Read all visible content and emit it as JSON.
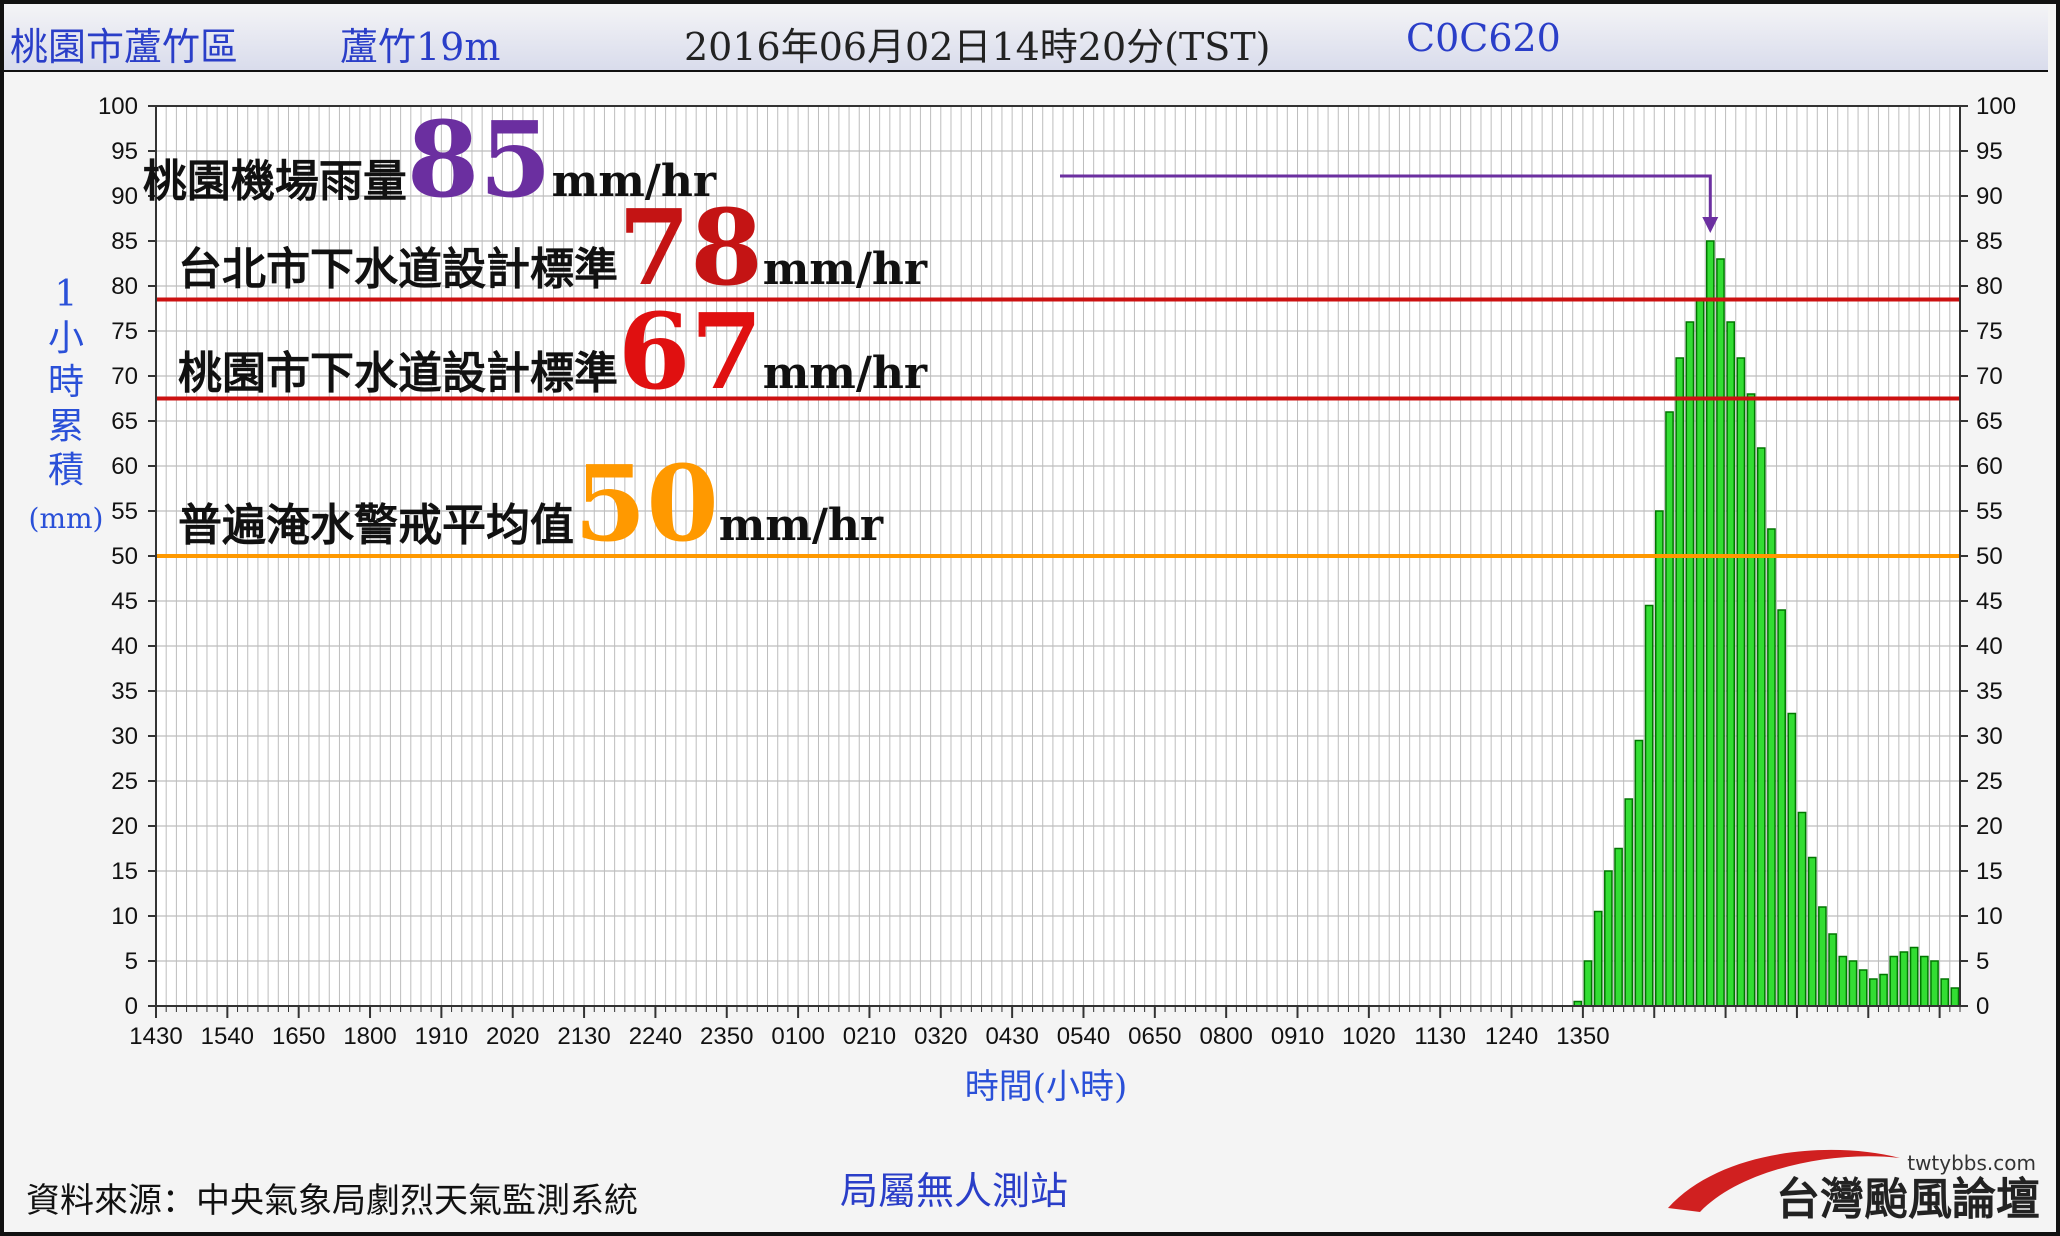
{
  "header": {
    "location": "桃園市蘆竹區",
    "station": "蘆竹19m",
    "datetime": "2016年06月02日14時20分(TST)",
    "station_code": "C0C620"
  },
  "annotations": {
    "airport_label": "桃園機場雨量",
    "airport_value": "85",
    "airport_unit": "mm/hr",
    "taipei_label": "台北市下水道設計標準",
    "taipei_value": "78",
    "taipei_unit": "mm/hr",
    "taoyuan_label": "桃園市下水道設計標準",
    "taoyuan_value": "67",
    "taoyuan_unit": "mm/hr",
    "warning_label": "普遍淹水警戒平均值",
    "warning_value": "50",
    "warning_unit": "mm/hr"
  },
  "footer": {
    "source": "資料來源：中央氣象局劇烈天氣監測系統",
    "station_type": "局屬無人測站",
    "forum_url": "twtybbs.com",
    "forum_name": "台灣颱風論壇"
  },
  "colors": {
    "bar": "#33dd33",
    "bar_edge": "#007700",
    "grid": "#bdbdbd",
    "axis_title": "#2a50d8",
    "airport": "#6b2fa0",
    "taipei": "#c41414",
    "taoyuan": "#e01010",
    "warning": "#ff9900",
    "threshold_red": "#cc1111"
  },
  "chart_data": {
    "type": "bar",
    "title": "",
    "xlabel": "時間(小時)",
    "ylabel": "1小時累積(mm)",
    "ylim": [
      0,
      100
    ],
    "yticks": [
      0,
      5,
      10,
      15,
      20,
      25,
      30,
      35,
      40,
      45,
      50,
      55,
      60,
      65,
      70,
      75,
      80,
      85,
      90,
      95,
      100
    ],
    "xticks": [
      "1430",
      "1540",
      "1650",
      "1800",
      "1910",
      "2020",
      "2130",
      "2240",
      "2350",
      "0100",
      "0210",
      "0320",
      "0430",
      "0540",
      "0650",
      "0800",
      "0910",
      "1020",
      "1130",
      "1240",
      "1350"
    ],
    "bar_interval_minutes": 10,
    "first_bar_time": "1430",
    "last_bar_time": "1420",
    "values": [
      0,
      0,
      0,
      0,
      0,
      0,
      0,
      0,
      0,
      0,
      0,
      0,
      0,
      0,
      0,
      0,
      0,
      0,
      0,
      0,
      0,
      0,
      0,
      0,
      0,
      0,
      0,
      0,
      0,
      0,
      0,
      0,
      0,
      0,
      0,
      0,
      0,
      0,
      0,
      0,
      0,
      0,
      0,
      0,
      0,
      0,
      0,
      0,
      0,
      0,
      0,
      0,
      0,
      0,
      0,
      0,
      0,
      0,
      0,
      0,
      0,
      0,
      0,
      0,
      0,
      0,
      0,
      0,
      0,
      0,
      0,
      0,
      0,
      0,
      0,
      0,
      0,
      0,
      0,
      0,
      0,
      0,
      0,
      0,
      0,
      0,
      0,
      0,
      0,
      0,
      0,
      0,
      0,
      0,
      0,
      0,
      0,
      0,
      0,
      0,
      0,
      0,
      0,
      0,
      0,
      0,
      0,
      0,
      0,
      0,
      0,
      0,
      0,
      0,
      0,
      0,
      0,
      0,
      0,
      0,
      0,
      0,
      0,
      0,
      0,
      0,
      0,
      0,
      0,
      0,
      0,
      0,
      0,
      0,
      0,
      0,
      0,
      0,
      0,
      0.5,
      5,
      10.5,
      15,
      17.5,
      23,
      29.5,
      44.5,
      55,
      66,
      72,
      76,
      78.5,
      85,
      83,
      76,
      72,
      68,
      62,
      53,
      44,
      32.5,
      21.5,
      16.5,
      11,
      8,
      5.5,
      5,
      4,
      3,
      3.5,
      5.5,
      6,
      6.5,
      5.5,
      5,
      3,
      2
    ],
    "thresholds": [
      {
        "label": "台北市下水道設計標準",
        "value": 78.5
      },
      {
        "label": "桃園市下水道設計標準",
        "value": 67.5
      },
      {
        "label": "普遍淹水警戒平均值",
        "value": 50
      }
    ],
    "grid": true,
    "legend": "none"
  }
}
